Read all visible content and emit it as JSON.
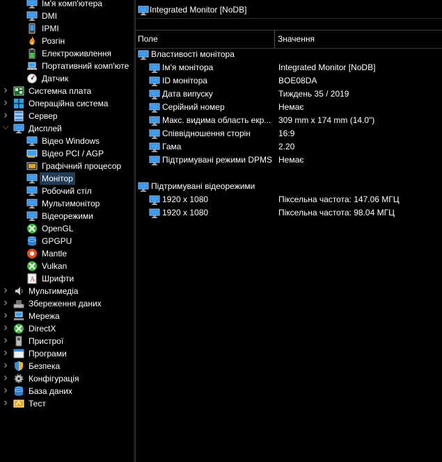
{
  "tree": {
    "items": [
      {
        "label": "Ім'я комп'ютера",
        "icon": "monitor-icon"
      },
      {
        "label": "DMI",
        "icon": "monitor-icon"
      },
      {
        "label": "IPMI",
        "icon": "phone-icon"
      },
      {
        "label": "Розгін",
        "icon": "flame-icon"
      },
      {
        "label": "Електроживлення",
        "icon": "battery-icon"
      },
      {
        "label": "Портативний комп'юте",
        "icon": "laptop-icon"
      },
      {
        "label": "Датчик",
        "icon": "gauge-icon"
      },
      {
        "label": "Системна плата",
        "icon": "motherboard-icon"
      },
      {
        "label": "Операційна система",
        "icon": "windows-icon"
      },
      {
        "label": "Сервер",
        "icon": "server-icon"
      },
      {
        "label": "Дисплей",
        "icon": "display-icon"
      },
      {
        "label": "Відео Windows",
        "icon": "monitor-icon"
      },
      {
        "label": "Відео PCI / AGP",
        "icon": "card-icon"
      },
      {
        "label": "Графічний процесор",
        "icon": "gpu-icon"
      },
      {
        "label": "Монітор",
        "icon": "monitor-icon"
      },
      {
        "label": "Робочий стіл",
        "icon": "monitor-icon"
      },
      {
        "label": "Мультимонітор",
        "icon": "monitor-icon"
      },
      {
        "label": "Відеорежими",
        "icon": "monitor-icon"
      },
      {
        "label": "OpenGL",
        "icon": "xbox-icon"
      },
      {
        "label": "GPGPU",
        "icon": "database-icon"
      },
      {
        "label": "Mantle",
        "icon": "mantle-icon"
      },
      {
        "label": "Vulkan",
        "icon": "xbox-icon"
      },
      {
        "label": "Шрифти",
        "icon": "font-icon"
      },
      {
        "label": "Мультимедіа",
        "icon": "speaker-icon"
      },
      {
        "label": "Збереження даних",
        "icon": "storage-icon"
      },
      {
        "label": "Мережа",
        "icon": "network-icon"
      },
      {
        "label": "DirectX",
        "icon": "xbox-icon"
      },
      {
        "label": "Пристрої",
        "icon": "device-icon"
      },
      {
        "label": "Програми",
        "icon": "programs-icon"
      },
      {
        "label": "Безпека",
        "icon": "shield-icon"
      },
      {
        "label": "Конфігурація",
        "icon": "gear-icon"
      },
      {
        "label": "База даних",
        "icon": "database-icon"
      },
      {
        "label": "Тест",
        "icon": "test-icon"
      }
    ],
    "selected": "Монітор"
  },
  "title": "Integrated Monitor [NoDB]",
  "header": {
    "field": "Поле",
    "value": "Значення"
  },
  "sections": [
    {
      "title": "Властивості монітора",
      "rows": [
        {
          "field": "Ім'я монітора",
          "value": "Integrated Monitor [NoDB]"
        },
        {
          "field": "ID монітора",
          "value": "BOE08DA"
        },
        {
          "field": "Дата випуску",
          "value": "Тиждень 35 / 2019"
        },
        {
          "field": "Серійний номер",
          "value": "Немає"
        },
        {
          "field": "Макс. видима область екр...",
          "value": "309 mm x 174 mm (14.0\")"
        },
        {
          "field": "Співвідношення сторін",
          "value": "16:9"
        },
        {
          "field": "Гама",
          "value": "2.20"
        },
        {
          "field": "Підтримувані режими DPMS",
          "value": "Немає"
        }
      ]
    },
    {
      "title": "Підтримувані відеорежими",
      "rows": [
        {
          "field": "1920 x 1080",
          "value": "Піксельна частота: 147.06 МГЦ"
        },
        {
          "field": "1920 x 1080",
          "value": "Піксельна частота: 98.04 МГЦ"
        }
      ]
    }
  ],
  "colors": {
    "background": "#000000",
    "selection": "#1f3d57",
    "monitor_icon": "#3a8fd9"
  }
}
